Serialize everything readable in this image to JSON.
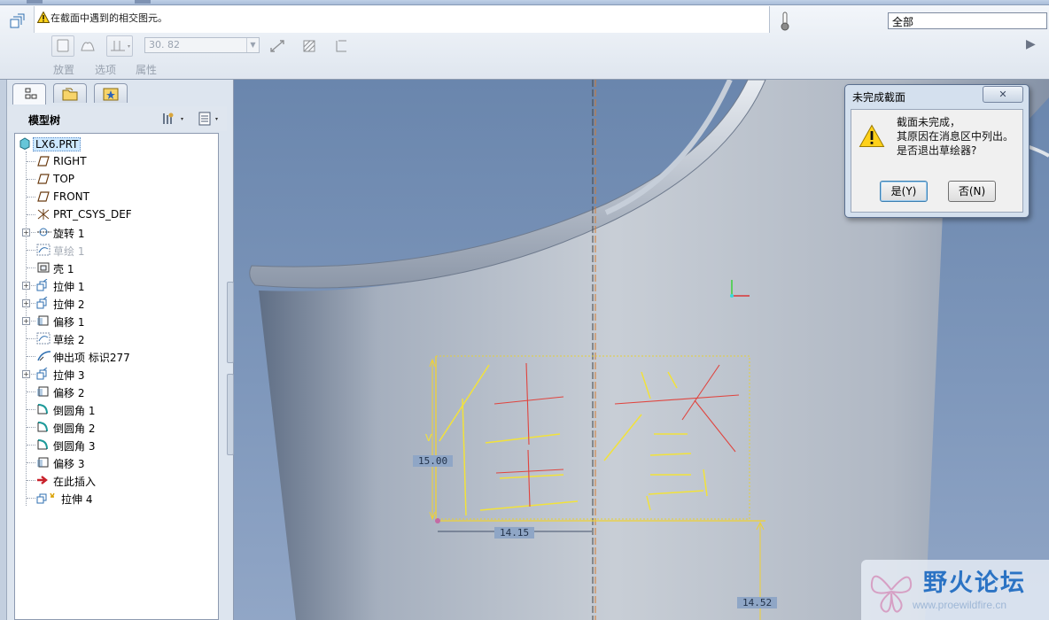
{
  "message_area": {
    "text": "在截面中遇到的相交图元。"
  },
  "filter": {
    "value": "全部"
  },
  "sketch_toolbar": {
    "dimension_value": "30. 82",
    "tabs": [
      "放置",
      "选项",
      "属性"
    ]
  },
  "model_tree": {
    "title": "模型树",
    "root": "LX6.PRT",
    "items": [
      {
        "label": "RIGHT",
        "icon": "datum-plane-icon",
        "expandable": false,
        "dim": false
      },
      {
        "label": "TOP",
        "icon": "datum-plane-icon",
        "expandable": false,
        "dim": false
      },
      {
        "label": "FRONT",
        "icon": "datum-plane-icon",
        "expandable": false,
        "dim": false
      },
      {
        "label": "PRT_CSYS_DEF",
        "icon": "csys-icon",
        "expandable": false,
        "dim": false
      },
      {
        "label": "旋转 1",
        "icon": "revolve-icon",
        "expandable": true,
        "dim": false
      },
      {
        "label": "草绘 1",
        "icon": "sketch-icon",
        "expandable": false,
        "dim": true
      },
      {
        "label": "壳 1",
        "icon": "shell-icon",
        "expandable": false,
        "dim": false
      },
      {
        "label": "拉伸 1",
        "icon": "extrude-icon",
        "expandable": true,
        "dim": false
      },
      {
        "label": "拉伸 2",
        "icon": "extrude-icon",
        "expandable": true,
        "dim": false
      },
      {
        "label": "偏移 1",
        "icon": "offset-icon",
        "expandable": true,
        "dim": false
      },
      {
        "label": "草绘 2",
        "icon": "sketch-icon",
        "expandable": false,
        "dim": false
      },
      {
        "label": "伸出项 标识277",
        "icon": "protrusion-icon",
        "expandable": false,
        "dim": false
      },
      {
        "label": "拉伸 3",
        "icon": "extrude-icon",
        "expandable": true,
        "dim": false
      },
      {
        "label": "偏移 2",
        "icon": "offset-icon",
        "expandable": false,
        "dim": false
      },
      {
        "label": "倒圆角 1",
        "icon": "round-icon",
        "expandable": false,
        "dim": false
      },
      {
        "label": "倒圆角 2",
        "icon": "round-icon",
        "expandable": false,
        "dim": false
      },
      {
        "label": "倒圆角 3",
        "icon": "round-icon",
        "expandable": false,
        "dim": false
      },
      {
        "label": "偏移 3",
        "icon": "offset-icon",
        "expandable": false,
        "dim": false
      },
      {
        "label": "在此插入",
        "icon": "insert-here-icon",
        "expandable": false,
        "dim": false
      },
      {
        "label": "拉伸 4",
        "icon": "extrude-new-icon",
        "expandable": false,
        "dim": false
      }
    ]
  },
  "viewport": {
    "dim_height": "15.00",
    "dim_width": "14.15",
    "dim_offset": "14.52",
    "sketch_text": "佳誉",
    "constraint_label": "V"
  },
  "dialog": {
    "title": "未完成截面",
    "lines": [
      "截面未完成，",
      "其原因在消息区中列出。",
      "是否退出草绘器?"
    ],
    "yes_label": "是(Y)",
    "no_label": "否(N)"
  },
  "watermark": {
    "title": "野火论坛",
    "url": "www.proewildfire.cn"
  }
}
